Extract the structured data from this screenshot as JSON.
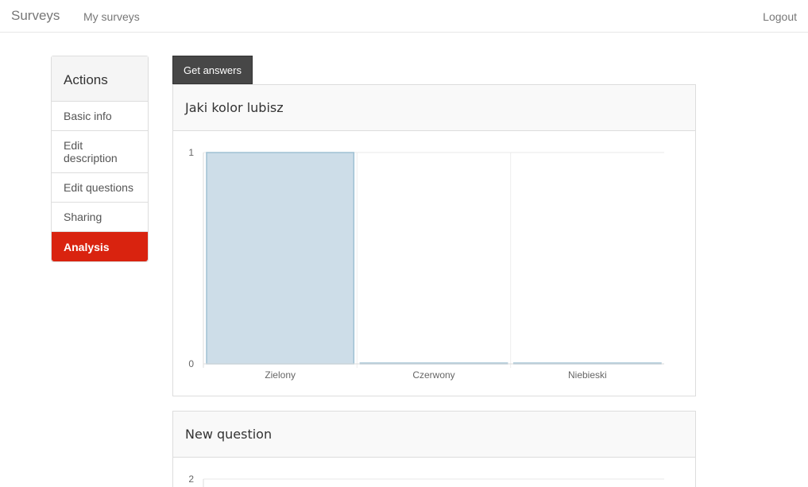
{
  "navbar": {
    "brand": "Surveys",
    "my_surveys": "My surveys",
    "logout": "Logout"
  },
  "sidebar": {
    "heading": "Actions",
    "items": [
      {
        "label": "Basic info"
      },
      {
        "label": "Edit description"
      },
      {
        "label": "Edit questions"
      },
      {
        "label": "Sharing"
      },
      {
        "label": "Analysis",
        "active": true
      }
    ]
  },
  "toolbar": {
    "get_answers_label": "Get answers"
  },
  "colors": {
    "accent": "#d9230f",
    "bar_fill": "#cddde8",
    "bar_stroke": "#9fc0d3"
  },
  "panels": [
    {
      "title": "Jaki kolor lubisz",
      "chart_data": {
        "type": "bar",
        "title": "",
        "categories": [
          "Zielony",
          "Czerwony",
          "Niebieski"
        ],
        "values": [
          1,
          0,
          0
        ],
        "yticks": [
          0,
          1
        ],
        "ylim": [
          0,
          1
        ],
        "xlabel": "",
        "ylabel": ""
      }
    },
    {
      "title": "New question",
      "chart_data": {
        "type": "bar",
        "title": "",
        "categories": [],
        "values": [],
        "yticks": [
          2
        ],
        "ylim": [
          0,
          2
        ],
        "xlabel": "",
        "ylabel": ""
      }
    }
  ]
}
